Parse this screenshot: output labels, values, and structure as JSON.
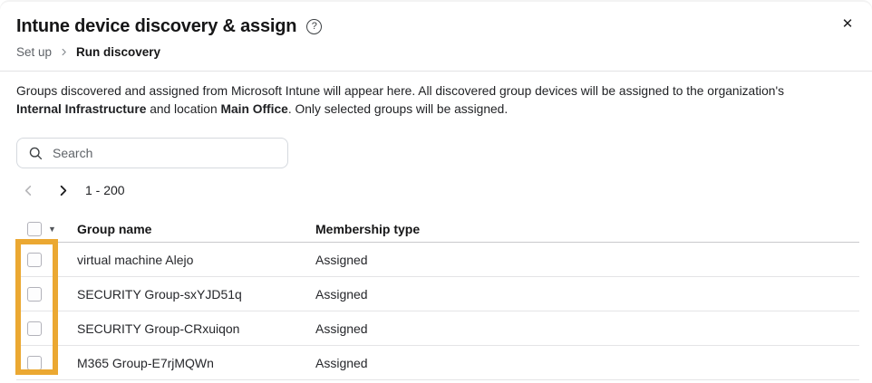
{
  "dialog": {
    "title": "Intune device discovery & assign",
    "help_icon": "?",
    "close_label": "✕"
  },
  "breadcrumb": {
    "parent": "Set up",
    "current": "Run discovery"
  },
  "description": {
    "line1": "Groups discovered and assigned from Microsoft Intune will appear here. All discovered group devices will be assigned to the organization's",
    "line2_bold1": "Internal Infrastructure",
    "line2_mid": " and location ",
    "line2_bold2": "Main Office",
    "line2_end": ". Only selected groups will be assigned."
  },
  "search": {
    "placeholder": "Search"
  },
  "pagination": {
    "range": "1 - 200"
  },
  "table": {
    "columns": [
      "Group name",
      "Membership type"
    ],
    "rows": [
      {
        "name": "virtual machine Alejo",
        "type": "Assigned",
        "checked": false
      },
      {
        "name": "SECURITY Group-sxYJD51q",
        "type": "Assigned",
        "checked": false
      },
      {
        "name": "SECURITY Group-CRxuiqon",
        "type": "Assigned",
        "checked": false
      },
      {
        "name": "M365 Group-E7rjMQWn",
        "type": "Assigned",
        "checked": false
      }
    ]
  },
  "highlight": {
    "color": "#eba832",
    "target": "checkbox-column"
  }
}
